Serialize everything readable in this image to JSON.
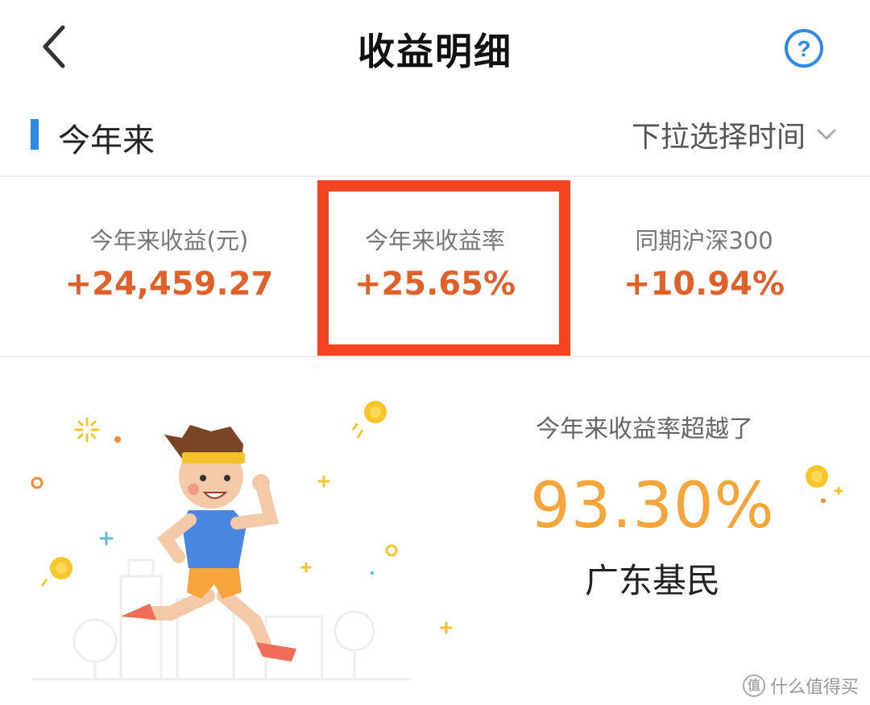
{
  "header": {
    "title": "收益明细",
    "back_icon": "chevron-left-icon",
    "help_icon": "question-circle-icon",
    "help_glyph": "?"
  },
  "section": {
    "title": "今年来",
    "time_select_label": "下拉选择时间",
    "time_select_icon": "chevron-down-icon",
    "accent_color": "#2f8ae5"
  },
  "stats": [
    {
      "label": "今年来收益(元)",
      "value": "+24,459.27"
    },
    {
      "label": "今年来收益率",
      "value": "+25.65%"
    },
    {
      "label": "同期沪深300",
      "value": "+10.94%"
    }
  ],
  "colors": {
    "stat_value": "#e0602a",
    "highlight_border": "#f44321",
    "beat_value": "#f5a53a"
  },
  "beat": {
    "label": "今年来收益率超越了",
    "value": "93.30%",
    "group": "广东基民"
  },
  "watermark": {
    "glyph": "值",
    "text": "什么值得买"
  }
}
